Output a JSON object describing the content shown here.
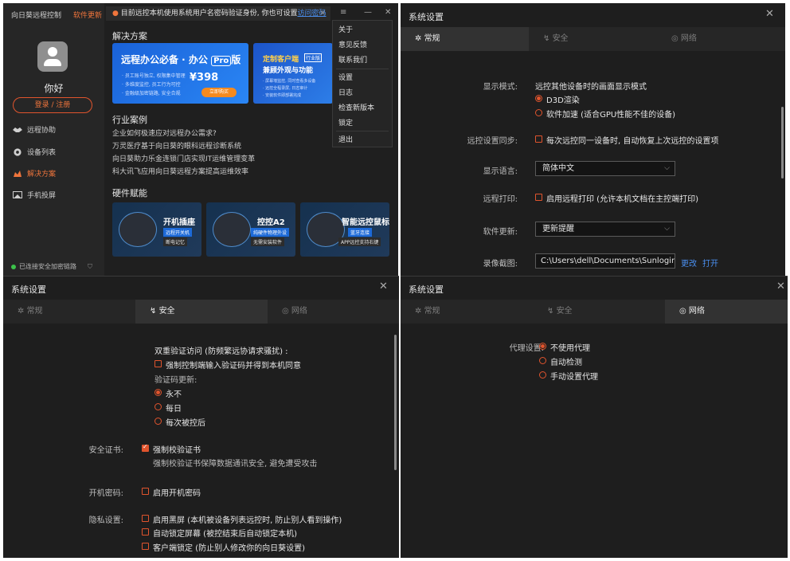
{
  "client": {
    "brand": "向日葵远程控制",
    "update": "软件更新",
    "hello": "你好",
    "login": "登录 / 注册",
    "nav": [
      "远程协助",
      "设备列表",
      "解决方案",
      "手机投屏"
    ],
    "footer": "已连接安全加密链路",
    "notice": "目前远控本机使用系统用户名密码验证身份, 你也可设置",
    "notice_link": "访问密码",
    "solutions_title": "解决方案",
    "banner1": {
      "title": "远程办公必备 · 办公",
      "pro": "Pro",
      "suffix": "版",
      "feat": [
        "· 员工账号独立, 权限集中管理",
        "· 多维度监控, 员工行为可控",
        "· 金融级加密链路, 安全合规"
      ],
      "price": "¥398",
      "cta": "立即购买"
    },
    "banner2": {
      "t1": "定制客户端",
      "tag": "行业版",
      "t2": "兼顾外观与功能",
      "feat": [
        "· 屏幕墙监控, 同时查看多设备",
        "· 远控全程录屏, 日志审计",
        "· 安装软件即部署完成"
      ]
    },
    "cases_title": "行业案例",
    "cases": [
      "企业如何极速应对远程办公需求?",
      "万灵医疗基于向日葵的眼科远程诊断系统",
      "向日葵助力乐金连锁门店实现IT运维管理变革",
      "科大讯飞应用向日葵远程方案提高运维效率"
    ],
    "hw_title": "硬件赋能",
    "hw": [
      {
        "t": "开机插座",
        "b1": "远程开关机",
        "b2": "断电记忆"
      },
      {
        "t": "控控A2",
        "b1": "纯硬件物理外设",
        "b2": "无需安装软件"
      },
      {
        "t": "智能远控鼠标",
        "b1": "蓝牙连接",
        "b2": "APP远控支持右键"
      }
    ],
    "menu": [
      "关于",
      "意见反馈",
      "联系我们",
      "设置",
      "日志",
      "检查新版本",
      "锁定",
      "退出"
    ]
  },
  "settings": {
    "title": "系统设置",
    "tabs": [
      "常规",
      "安全",
      "网络"
    ],
    "general": {
      "display_mode_label": "显示模式:",
      "display_mode_desc": "远控其他设备时的画面显示模式",
      "display_opts": [
        "D3D渲染",
        "软件加速 (适合GPU性能不佳的设备)"
      ],
      "sync_label": "远控设置同步:",
      "sync_opt": "每次远控同一设备时, 自动恢复上次远控的设置项",
      "lang_label": "显示语言:",
      "lang_value": "简体中文",
      "print_label": "远程打印:",
      "print_opt": "启用远程打印 (允许本机文档在主控端打印)",
      "update_label": "软件更新:",
      "update_value": "更新提醒",
      "capture_label": "录像截图:",
      "capture_path": "C:\\Users\\dell\\Documents\\Sunlogin",
      "change": "更改",
      "open": "打开"
    },
    "security": {
      "twofa_title": "双重验证访问 (防频繁远协请求骚扰) :",
      "twofa_opt": "强制控制端输入验证码并得到本机同意",
      "code_update": "验证码更新:",
      "code_opts": [
        "永不",
        "每日",
        "每次被控后"
      ],
      "cert_label": "安全证书:",
      "cert_opt": "强制校验证书",
      "cert_desc": "强制校验证书保障数据通讯安全, 避免遭受攻击",
      "boot_label": "开机密码:",
      "boot_opt": "启用开机密码",
      "privacy_label": "隐私设置:",
      "privacy_opts": [
        "启用黑屏 (本机被设备列表远控时, 防止别人看到操作)",
        "自动锁定屏幕 (被控结束后自动锁定本机)",
        "客户端锁定 (防止别人修改你的向日葵设置)"
      ]
    },
    "network": {
      "proxy_label": "代理设置:",
      "proxy_opts": [
        "不使用代理",
        "自动检测",
        "手动设置代理"
      ]
    }
  },
  "colors": {
    "accent": "#e0542d",
    "link": "#4a8ff0",
    "bg": "#1e1e1e"
  }
}
